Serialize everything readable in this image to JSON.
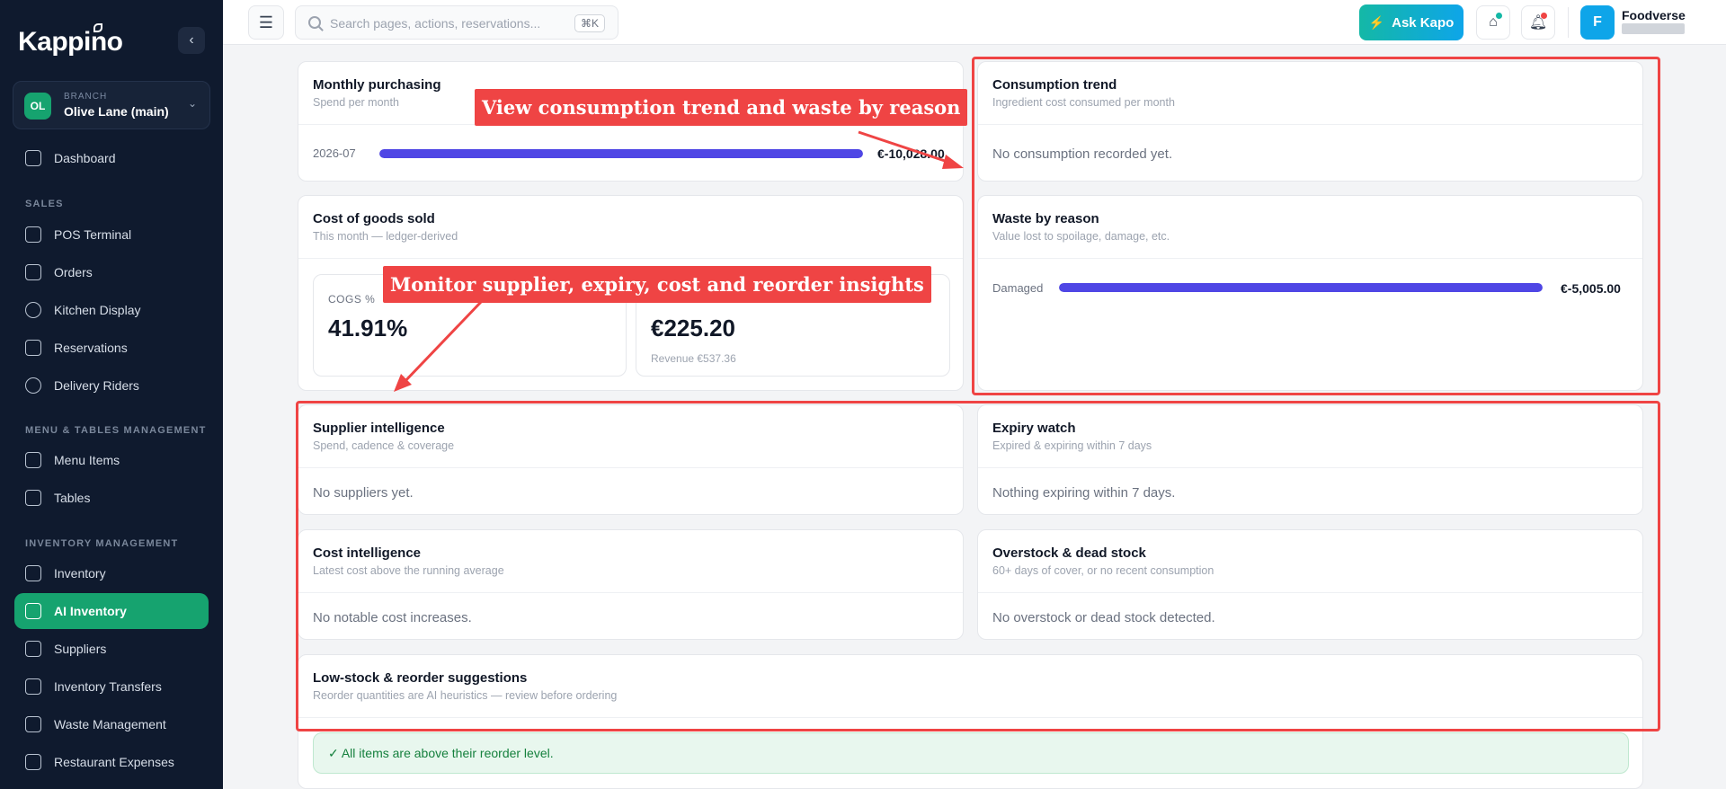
{
  "brand": {
    "name": "Kappino"
  },
  "branch": {
    "avatar": "OL",
    "label": "BRANCH",
    "name": "Olive Lane (main)"
  },
  "nav": {
    "dashboard": "Dashboard",
    "sales_section": "SALES",
    "pos": "POS Terminal",
    "orders": "Orders",
    "kitchen": "Kitchen Display",
    "reservations": "Reservations",
    "riders": "Delivery Riders",
    "menu_section": "MENU & TABLES MANAGEMENT",
    "menu_items": "Menu Items",
    "tables": "Tables",
    "inventory_section": "INVENTORY MANAGEMENT",
    "inventory": "Inventory",
    "ai_inventory": "AI Inventory",
    "suppliers": "Suppliers",
    "transfers": "Inventory Transfers",
    "waste": "Waste Management",
    "expenses": "Restaurant Expenses"
  },
  "topbar": {
    "search_placeholder": "Search pages, actions, reservations...",
    "shortcut": "⌘K",
    "ask_label": "Ask Kapo",
    "user_initial": "F",
    "user_name": "Foodverse"
  },
  "cards": {
    "monthly": {
      "title": "Monthly purchasing",
      "sub": "Spend per month",
      "row_label": "2026-07",
      "row_value": "€-10,028.00",
      "fill": 1.0
    },
    "consumption": {
      "title": "Consumption trend",
      "sub": "Ingredient cost consumed per month",
      "empty": "No consumption recorded yet."
    },
    "cogs": {
      "title": "Cost of goods sold",
      "sub": "This month — ledger-derived",
      "m1_label": "COGS %",
      "m1_value": "41.91%",
      "m2_value": "€225.20",
      "m2_sub": "Revenue €537.36"
    },
    "waste": {
      "title": "Waste by reason",
      "sub": "Value lost to spoilage, damage, etc.",
      "row_label": "Damaged",
      "row_value": "€-5,005.00",
      "fill": 1.0
    },
    "supplier": {
      "title": "Supplier intelligence",
      "sub": "Spend, cadence & coverage",
      "empty": "No suppliers yet."
    },
    "expiry": {
      "title": "Expiry watch",
      "sub": "Expired & expiring within 7 days",
      "empty": "Nothing expiring within 7 days."
    },
    "cost": {
      "title": "Cost intelligence",
      "sub": "Latest cost above the running average",
      "empty": "No notable cost increases."
    },
    "overstock": {
      "title": "Overstock & dead stock",
      "sub": "60+ days of cover, or no recent consumption",
      "empty": "No overstock or dead stock detected."
    },
    "lowstock": {
      "title": "Low-stock & reorder suggestions",
      "sub": "Reorder quantities are AI heuristics — review before ordering",
      "notice": "✓ All items are above their reorder level."
    }
  },
  "annotations": {
    "callout1": "View consumption trend and waste by reason",
    "callout2": "Monitor supplier, expiry, cost and reorder insights"
  },
  "colors": {
    "accent": "#16a36f",
    "bar": "#4f46e5",
    "annotation": "#ef4444",
    "sidebar": "#0f1a2e"
  }
}
